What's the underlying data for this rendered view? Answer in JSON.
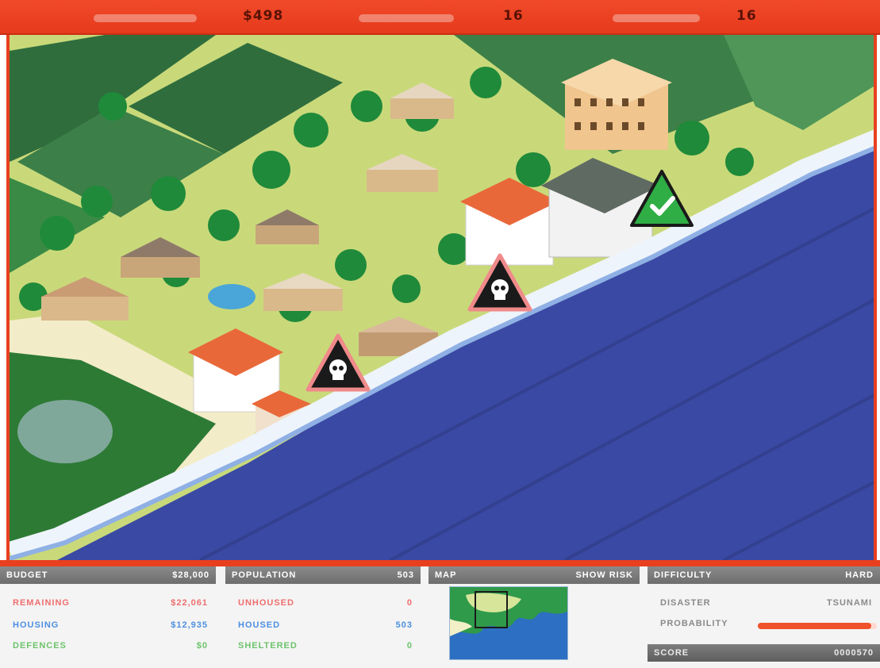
{
  "hud": {
    "money": "$498",
    "counter_1": "16",
    "counter_2": "16"
  },
  "markers": [
    {
      "type": "danger",
      "icon": "skull-icon"
    },
    {
      "type": "danger",
      "icon": "skull-icon"
    },
    {
      "type": "safe",
      "icon": "checkmark-icon"
    }
  ],
  "budget": {
    "header_label": "BUDGET",
    "header_value": "$28,000",
    "remaining_label": "REMAINING",
    "remaining_value": "$22,061",
    "housing_label": "HOUSING",
    "housing_value": "$12,935",
    "defences_label": "DEFENCES",
    "defences_value": "$0"
  },
  "population": {
    "header_label": "POPULATION",
    "header_value": "503",
    "unhoused_label": "UNHOUSED",
    "unhoused_value": "0",
    "housed_label": "HOUSED",
    "housed_value": "503",
    "sheltered_label": "SHELTERED",
    "sheltered_value": "0"
  },
  "map_panel": {
    "header_label": "MAP",
    "header_action": "SHOW RISK"
  },
  "difficulty": {
    "header_label": "DIFFICULTY",
    "header_value": "HARD",
    "disaster_label": "DISASTER",
    "disaster_value": "TSUNAMI",
    "probability_label": "PROBABILITY",
    "probability_level": 0.95,
    "score_label": "SCORE",
    "score_value": "0000570"
  },
  "colors": {
    "hud_red": "#e8401f",
    "ocean": "#3a49a3",
    "grass": "#c9d97a",
    "danger": "#e23a3a",
    "safe": "#2fae45"
  }
}
